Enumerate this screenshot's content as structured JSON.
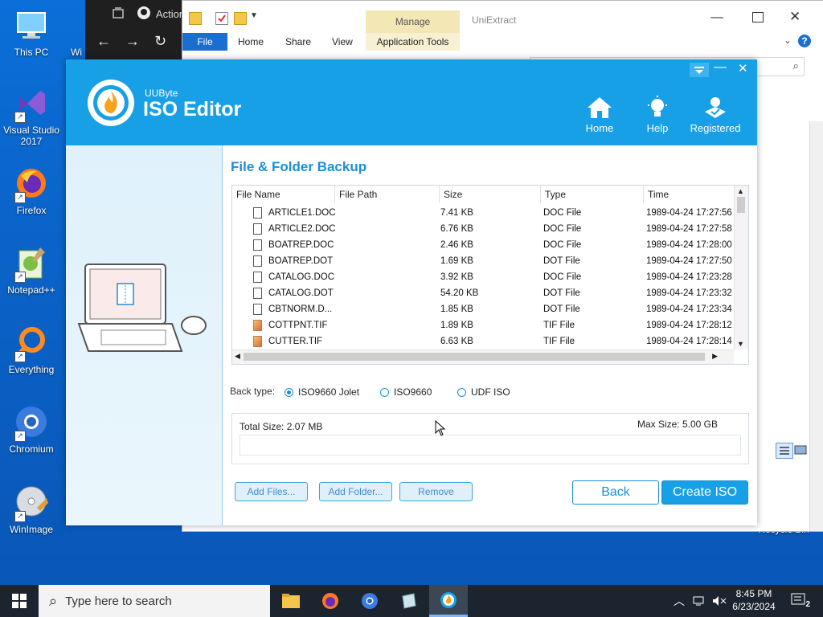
{
  "desktop": {
    "icons": [
      {
        "label": "This PC"
      },
      {
        "label": "Visual Studio 2017"
      },
      {
        "label": "Firefox"
      },
      {
        "label": "Notepad++"
      },
      {
        "label": "Everything"
      },
      {
        "label": "Chromium"
      },
      {
        "label": "WinImage"
      },
      {
        "label": "Recycle Bin"
      }
    ],
    "partial_label": "Wi"
  },
  "browser": {
    "tab_label": "Action"
  },
  "explorer": {
    "title": "UniExtract",
    "manage_tab": "Manage",
    "ribbon_tabs": [
      "File",
      "Home",
      "Share",
      "View",
      "Application Tools"
    ]
  },
  "iso": {
    "brand_small": "UUByte",
    "brand_big": "ISO Editor",
    "nav": [
      {
        "label": "Home",
        "icon": "home-icon"
      },
      {
        "label": "Help",
        "icon": "lightbulb-icon"
      },
      {
        "label": "Registered",
        "icon": "user-check-icon"
      }
    ],
    "section_title": "File & Folder Backup",
    "columns": [
      "File Name",
      "File Path",
      "Size",
      "Type",
      "Time"
    ],
    "rows": [
      {
        "name": "ARTICLE1.DOC",
        "path": "",
        "size": "7.41 KB",
        "type": "DOC File",
        "time": "1989-04-24 17:27:56",
        "kind": "doc"
      },
      {
        "name": "ARTICLE2.DOC",
        "path": "",
        "size": "6.76 KB",
        "type": "DOC File",
        "time": "1989-04-24 17:27:58",
        "kind": "doc"
      },
      {
        "name": "BOATREP.DOC",
        "path": "",
        "size": "2.46 KB",
        "type": "DOC File",
        "time": "1989-04-24 17:28:00",
        "kind": "doc"
      },
      {
        "name": "BOATREP.DOT",
        "path": "",
        "size": "1.69 KB",
        "type": "DOT File",
        "time": "1989-04-24 17:27:50",
        "kind": "doc"
      },
      {
        "name": "CATALOG.DOC",
        "path": "",
        "size": "3.92 KB",
        "type": "DOC File",
        "time": "1989-04-24 17:23:28",
        "kind": "doc"
      },
      {
        "name": "CATALOG.DOT",
        "path": "",
        "size": "54.20 KB",
        "type": "DOT File",
        "time": "1989-04-24 17:23:32",
        "kind": "doc"
      },
      {
        "name": "CBTNORM.D...",
        "path": "",
        "size": "1.85 KB",
        "type": "DOT File",
        "time": "1989-04-24 17:23:34",
        "kind": "doc"
      },
      {
        "name": "COTTPNT.TIF",
        "path": "",
        "size": "1.89 KB",
        "type": "TIF File",
        "time": "1989-04-24 17:28:12",
        "kind": "tif"
      },
      {
        "name": "CUTTER.TIF",
        "path": "",
        "size": "6.63 KB",
        "type": "TIF File",
        "time": "1989-04-24 17:28:14",
        "kind": "tif"
      }
    ],
    "back_type_label": "Back type:",
    "back_types": [
      {
        "label": "ISO9660 Jolet",
        "selected": true
      },
      {
        "label": "ISO9660",
        "selected": false
      },
      {
        "label": "UDF ISO",
        "selected": false
      }
    ],
    "total_size": "Total Size: 2.07 MB",
    "max_size": "Max Size: 5.00 GB",
    "buttons": {
      "add_files": "Add Files...",
      "add_folder": "Add Folder...",
      "remove": "Remove",
      "back": "Back",
      "create_iso": "Create ISO"
    }
  },
  "taskbar": {
    "search_placeholder": "Type here to search",
    "time": "8:45 PM",
    "date": "6/23/2024",
    "notification_count": "2"
  },
  "colors": {
    "accent": "#18a0e6",
    "desktop": "#0b63c9",
    "taskbar": "#1c2430"
  }
}
